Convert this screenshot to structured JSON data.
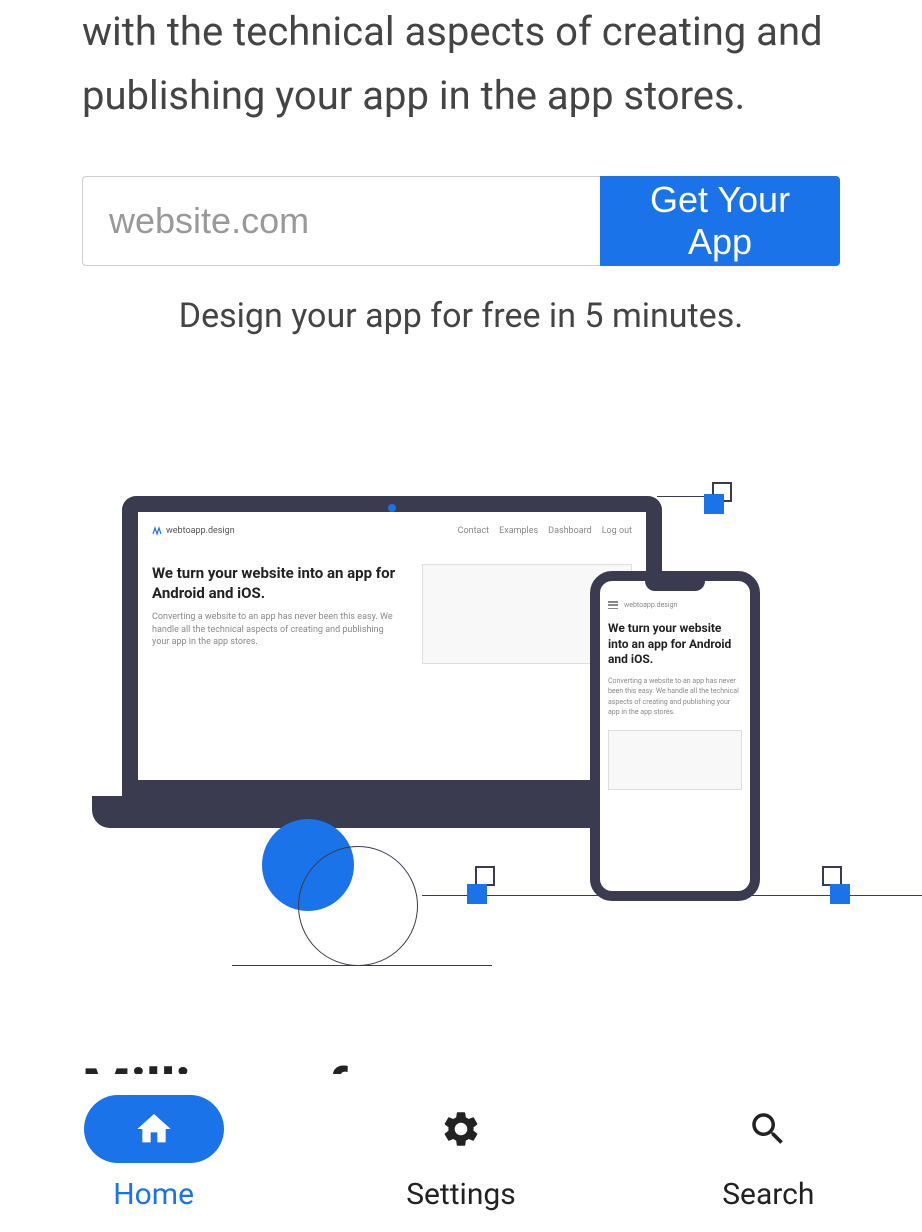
{
  "hero": {
    "description": "with the technical aspects of creating and publishing your app in the app stores.",
    "input_placeholder": "website.com",
    "cta_label": "Get Your App",
    "subtext": "Design your app for free in 5 minutes."
  },
  "mock": {
    "brand": "webtoapp.design",
    "nav": [
      "Contact",
      "Examples",
      "Dashboard",
      "Log out"
    ],
    "heading": "We turn your website into an app for Android and iOS.",
    "paragraph": "Converting a website to an app has never been this easy. We handle all the technical aspects of creating and publishing your app in the app stores."
  },
  "peek_heading": "Millions of",
  "nav": {
    "items": [
      {
        "label": "Home",
        "icon": "home-icon",
        "active": true
      },
      {
        "label": "Settings",
        "icon": "gear-icon",
        "active": false
      },
      {
        "label": "Search",
        "icon": "search-icon",
        "active": false
      }
    ]
  },
  "colors": {
    "accent": "#1a73e8",
    "dark": "#3b3b4f"
  }
}
